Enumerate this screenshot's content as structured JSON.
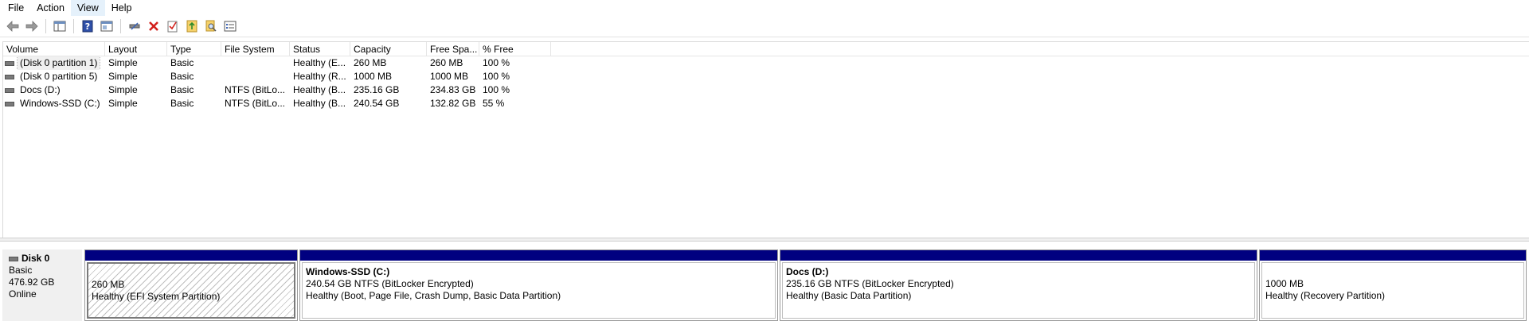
{
  "menu": [
    "File",
    "Action",
    "View",
    "Help"
  ],
  "columns": [
    "Volume",
    "Layout",
    "Type",
    "File System",
    "Status",
    "Capacity",
    "Free Spa...",
    "% Free"
  ],
  "volumes": [
    {
      "volume": "(Disk 0 partition 1)",
      "layout": "Simple",
      "type": "Basic",
      "fs": "",
      "status": "Healthy (E...",
      "capacity": "260 MB",
      "free": "260 MB",
      "pct": "100 %"
    },
    {
      "volume": "(Disk 0 partition 5)",
      "layout": "Simple",
      "type": "Basic",
      "fs": "",
      "status": "Healthy (R...",
      "capacity": "1000 MB",
      "free": "1000 MB",
      "pct": "100 %"
    },
    {
      "volume": "Docs (D:)",
      "layout": "Simple",
      "type": "Basic",
      "fs": "NTFS (BitLo...",
      "status": "Healthy (B...",
      "capacity": "235.16 GB",
      "free": "234.83 GB",
      "pct": "100 %"
    },
    {
      "volume": "Windows-SSD (C:)",
      "layout": "Simple",
      "type": "Basic",
      "fs": "NTFS (BitLo...",
      "status": "Healthy (B...",
      "capacity": "240.54 GB",
      "free": "132.82 GB",
      "pct": "55 %"
    }
  ],
  "disk": {
    "name": "Disk 0",
    "type": "Basic",
    "size": "476.92 GB",
    "state": "Online"
  },
  "partitions": [
    {
      "title": "",
      "line1": "260 MB",
      "line2": "Healthy (EFI System Partition)"
    },
    {
      "title": "Windows-SSD  (C:)",
      "line1": "240.54 GB NTFS (BitLocker Encrypted)",
      "line2": "Healthy (Boot, Page File, Crash Dump, Basic Data Partition)"
    },
    {
      "title": "Docs  (D:)",
      "line1": "235.16 GB NTFS (BitLocker Encrypted)",
      "line2": "Healthy (Basic Data Partition)"
    },
    {
      "title": "",
      "line1": "1000 MB",
      "line2": "Healthy (Recovery Partition)"
    }
  ],
  "colors": {
    "partition_bar": "#000080",
    "menu_active": "#e5f1fb"
  },
  "toolbar_icons": [
    "back-arrow-icon",
    "forward-arrow-icon",
    "show-hide-console-tree-icon",
    "help-icon",
    "properties-icon",
    "connect-drive-icon",
    "delete-icon",
    "check-icon",
    "export-icon",
    "search-icon",
    "list-view-icon"
  ]
}
